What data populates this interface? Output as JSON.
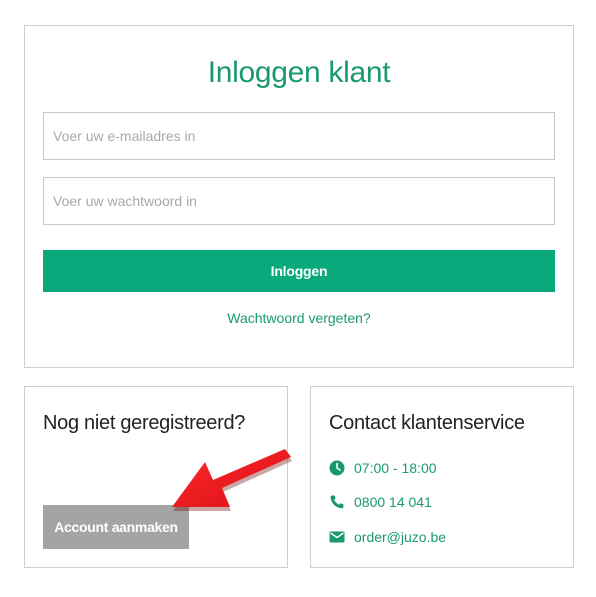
{
  "login": {
    "title": "Inloggen klant",
    "email_placeholder": "Voer uw e-mailadres in",
    "password_placeholder": "Voer uw wachtwoord in",
    "submit_label": "Inloggen",
    "forgot_label": "Wachtwoord vergeten?"
  },
  "register": {
    "heading": "Nog niet geregistreerd?",
    "button_label": "Account aanmaken"
  },
  "contact": {
    "heading": "Contact klantenservice",
    "items": [
      {
        "icon": "clock-icon",
        "text": "07:00 - 18:00"
      },
      {
        "icon": "phone-icon",
        "text": "0800 14 041"
      },
      {
        "icon": "envelope-icon",
        "text": "order@juzo.be"
      }
    ]
  },
  "colors": {
    "accent": "#0aa97c",
    "accent_text": "#1a9a6c",
    "secondary_button": "#a4a4a4",
    "annotation_arrow": "#e8141c"
  }
}
